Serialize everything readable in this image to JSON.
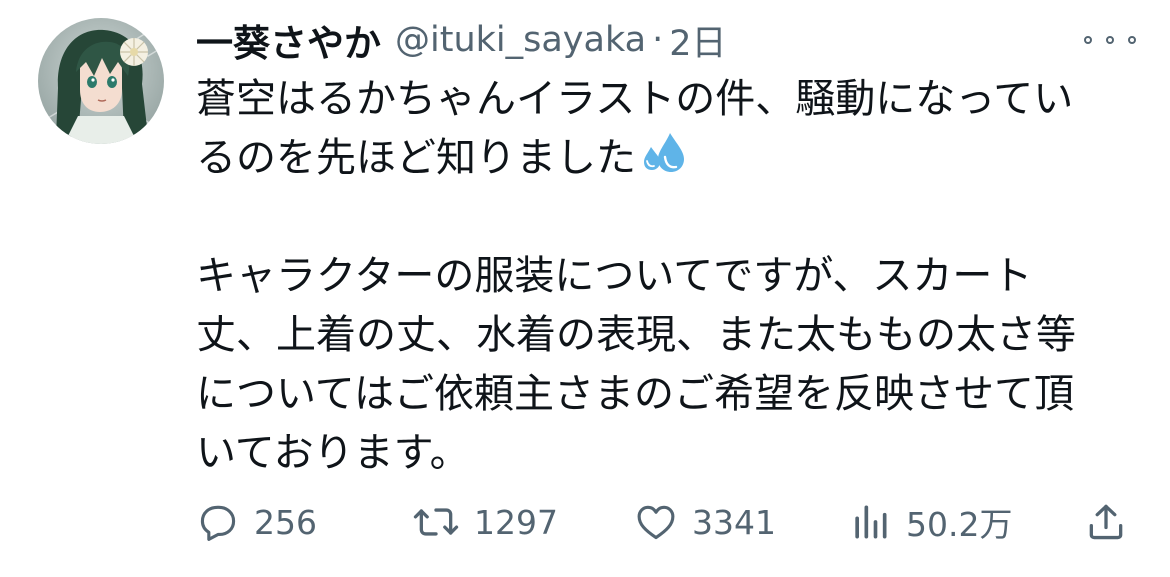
{
  "tweet": {
    "author": {
      "display_name": "一葵さやか",
      "handle": "@ituki_sayaka",
      "separator": "·",
      "time": "2日"
    },
    "text_lines": [
      "蒼空はるかちゃんイラストの件、騒動になってい",
      "るのを先ほど知りました",
      "",
      "キャラクターの服装についてですが、スカート",
      "丈、上着の丈、水着の表現、また太ももの太さ等",
      "についてはご依頼主さまのご希望を反映させて頂",
      "いております。"
    ],
    "emoji": "sweat-droplets-icon",
    "actions": {
      "reply_count": "256",
      "retweet_count": "1297",
      "like_count": "3341",
      "views_count": "50.2万"
    }
  },
  "colors": {
    "text": "#0f1419",
    "secondary": "#536471",
    "background": "#ffffff",
    "emoji_blue": "#5fb4e8"
  }
}
